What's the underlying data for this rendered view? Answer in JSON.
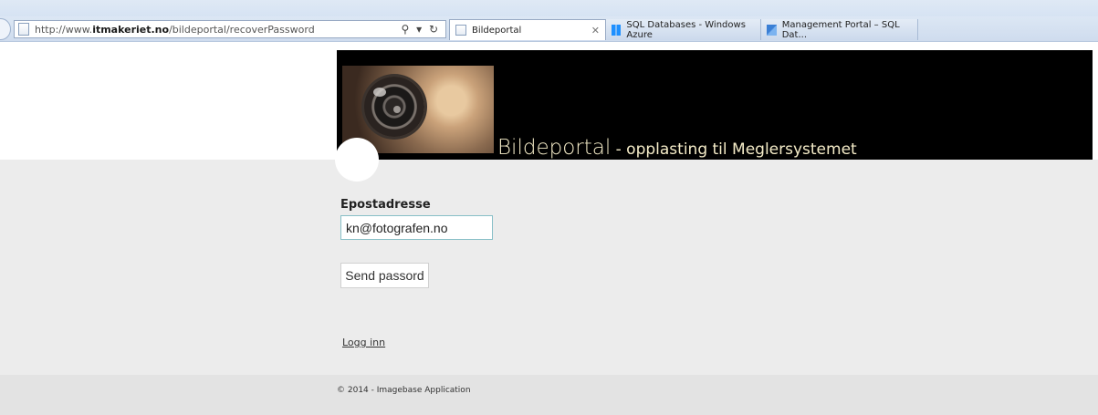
{
  "browser": {
    "address": {
      "url_prefix": "http://www.",
      "url_host": "itmakeriet.no",
      "url_path": "/bildeportal/recoverPassword"
    },
    "tabs": [
      {
        "label": "Bildeportal",
        "icon": "page-icon",
        "active": true
      },
      {
        "label": "SQL Databases - Windows Azure",
        "icon": "sql-databases-icon",
        "active": false
      },
      {
        "label": "Management Portal – SQL Dat...",
        "icon": "azure-icon",
        "active": false
      }
    ]
  },
  "header": {
    "brand_title": "Bildeportal",
    "brand_subtitle": " - opplasting til Meglersystemet"
  },
  "form": {
    "email_label": "Epostadresse",
    "email_value": "kn@fotografen.no",
    "send_button": "Send passord",
    "login_link": "Logg inn"
  },
  "footer": {
    "text": "© 2014 - Imagebase Application"
  }
}
